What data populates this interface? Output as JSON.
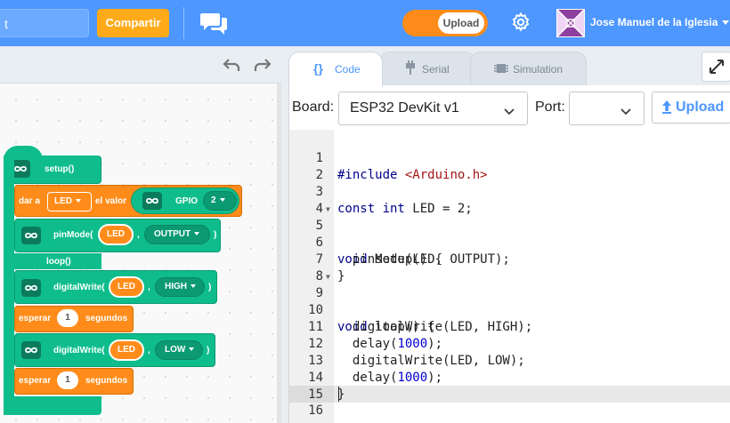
{
  "header": {
    "project_name": "t",
    "share_label": "Compartir",
    "mode_label": "Upload",
    "user_name": "Jose Manuel de la Iglesia",
    "icons": {
      "feedback": "chat-bubbles-icon",
      "settings": "gear-icon",
      "user_menu": "chevron-down-icon"
    }
  },
  "workspace": {
    "icons": {
      "undo": "undo-icon",
      "redo": "redo-icon"
    },
    "blocks": {
      "setup_label": "setup()",
      "set_prefix": "dar a",
      "set_var": "LED",
      "set_mid": "el valor",
      "gpio_label": "GPIO",
      "gpio_value": "2",
      "pinmode_label": "pinMode(",
      "pinmode_pin": "LED",
      "pinmode_mode": "OUTPUT",
      "paren_close": ")",
      "comma": ",",
      "loop_label": "loop()",
      "dw1_label": "digitalWrite(",
      "dw1_pin": "LED",
      "dw1_state": "HIGH",
      "wait1_prefix": "esperar",
      "wait1_value": "1",
      "wait1_suffix": "segundos",
      "dw2_label": "digitalWrite(",
      "dw2_pin": "LED",
      "dw2_state": "LOW",
      "wait2_prefix": "esperar",
      "wait2_value": "1",
      "wait2_suffix": "segundos"
    }
  },
  "code_panel": {
    "tabs": [
      {
        "label": "Code",
        "icon": "code-braces-icon",
        "active": true
      },
      {
        "label": "Serial",
        "icon": "plug-icon",
        "active": false
      },
      {
        "label": "Simulation",
        "icon": "chip-icon",
        "active": false
      }
    ],
    "board_label": "Board:",
    "board_value": "ESP32 DevKit v1",
    "port_label": "Port:",
    "port_value": "",
    "upload_label": "Upload",
    "line_numbers": [
      "1",
      "2",
      "3",
      "4",
      "5",
      "6",
      "7",
      "8",
      "9",
      "10",
      "11",
      "12",
      "13",
      "14",
      "15",
      "16"
    ],
    "code": {
      "l1_kw": "#include",
      "l1_str": "<Arduino.h>",
      "l3_kw": "const int",
      "l3_rest": " LED = 2;",
      "l5_kw": "void",
      "l5_rest": " setup() {",
      "l6": "  pinMode(LED, OUTPUT);",
      "l7": "}",
      "l9_kw": "void",
      "l9_rest": " loop() {",
      "l10": "  digitalWrite(LED, HIGH);",
      "l11_a": "  delay(",
      "l11_num": "1000",
      "l11_b": ");",
      "l12": "  digitalWrite(LED, LOW);",
      "l13_a": "  delay(",
      "l13_num": "1000",
      "l13_b": ");",
      "l14": "}"
    }
  },
  "colors": {
    "header_blue": "#4d97ff",
    "share_orange": "#ffab19",
    "block_green": "#0fbd8c",
    "block_orange": "#ff8c1a"
  }
}
